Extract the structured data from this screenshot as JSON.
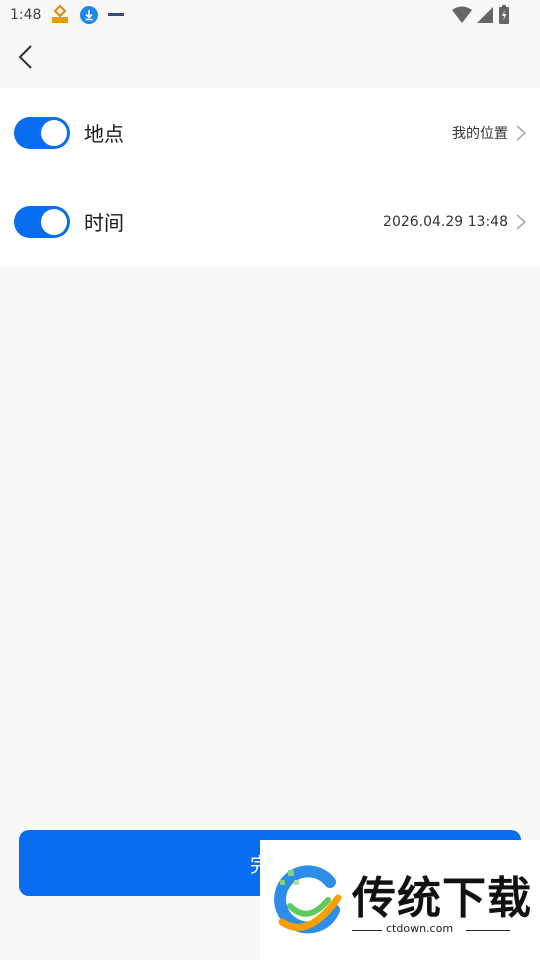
{
  "status_bar": {
    "time": "1:48",
    "icons": [
      "app-notification-icon",
      "download-icon",
      "small-notification-icon",
      "wifi-icon",
      "signal-icon",
      "battery-icon"
    ]
  },
  "nav": {
    "back_icon": "chevron-left-icon"
  },
  "settings": [
    {
      "label": "地点",
      "value": "我的位置",
      "enabled": true
    },
    {
      "label": "时间",
      "value": "2026.04.29 13:48",
      "enabled": true
    }
  ],
  "done_button": {
    "label": "完成"
  },
  "watermark": {
    "title": "传统下载",
    "url": "ctdown.com"
  },
  "colors": {
    "accent": "#0a6cf0",
    "background": "#f8f8f8",
    "card": "#ffffff"
  }
}
